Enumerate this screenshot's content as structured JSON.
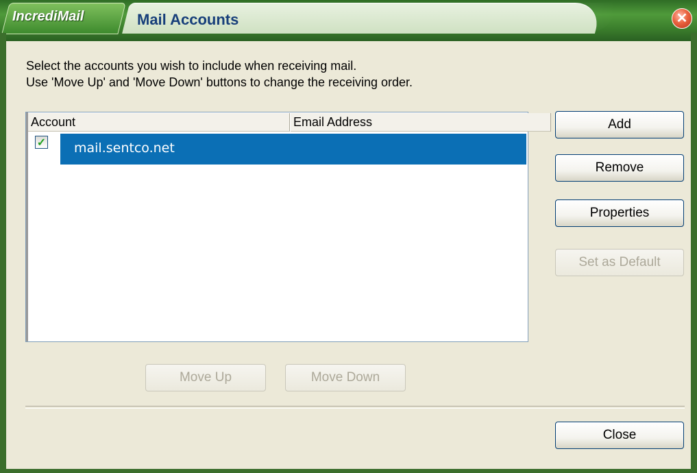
{
  "window": {
    "brand": "IncrediMail",
    "title": "Mail Accounts",
    "close_icon": "close-icon"
  },
  "instructions": {
    "line1": "Select the accounts you wish to include when receiving mail.",
    "line2": "Use 'Move Up' and 'Move Down' buttons to change the receiving order."
  },
  "accounts_list": {
    "columns": [
      "Account",
      "Email Address"
    ],
    "rows": [
      {
        "checked": true,
        "account": "mail.sentco.net",
        "email": ""
      }
    ]
  },
  "buttons": {
    "add": "Add",
    "remove": "Remove",
    "properties": "Properties",
    "set_default": "Set as Default",
    "move_up": "Move Up",
    "move_down": "Move Down",
    "close": "Close"
  },
  "colors": {
    "titlebar_green": "#3b7e2c",
    "selection_blue": "#0b6fb5",
    "title_text": "#173f7a",
    "dialog_bg": "#ece9d8"
  }
}
